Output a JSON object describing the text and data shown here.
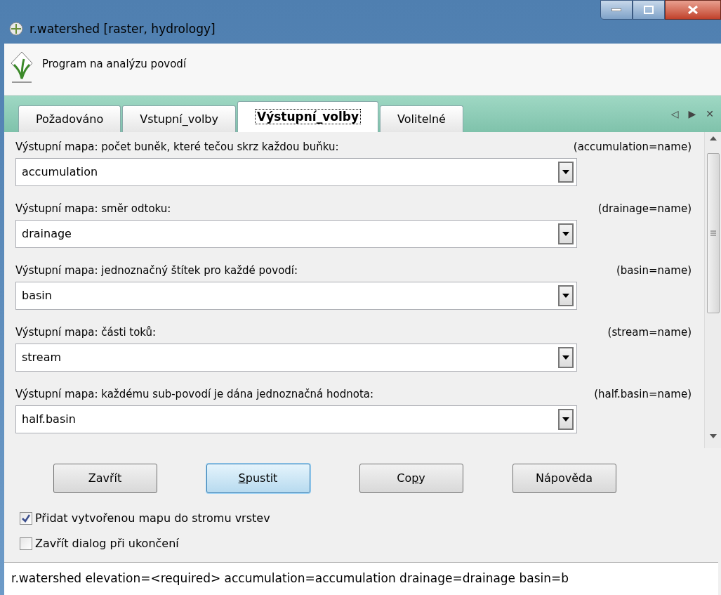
{
  "window": {
    "title": "r.watershed [raster, hydrology]"
  },
  "header": {
    "description": "Program na analýzu povodí"
  },
  "tabs": [
    {
      "label": "Požadováno",
      "selected": false
    },
    {
      "label": "Vstupní_volby",
      "selected": false
    },
    {
      "label": "Výstupní_volby",
      "selected": true
    },
    {
      "label": "Volitelné",
      "selected": false
    }
  ],
  "tab_nav": [
    "◁",
    "▶",
    "✕"
  ],
  "options": [
    {
      "label": "Výstupní mapa: počet buněk, které tečou skrz každou buňku:",
      "key": "(accumulation=name)",
      "value": "accumulation"
    },
    {
      "label": "Výstupní mapa: směr odtoku:",
      "key": "(drainage=name)",
      "value": "drainage"
    },
    {
      "label": "Výstupní mapa: jednoznačný štítek pro každé povodí:",
      "key": "(basin=name)",
      "value": "basin"
    },
    {
      "label": "Výstupní mapa: části toků:",
      "key": "(stream=name)",
      "value": "stream"
    },
    {
      "label": "Výstupní mapa: každému sub-povodí je dána jednoznačná hodnota:",
      "key": "(half.basin=name)",
      "value": "half.basin"
    }
  ],
  "buttons": [
    {
      "parts": [
        {
          "t": "Zavřít",
          "u": false
        }
      ],
      "default": false
    },
    {
      "parts": [
        {
          "t": "S",
          "u": true
        },
        {
          "t": "pustit",
          "u": false
        }
      ],
      "default": true
    },
    {
      "parts": [
        {
          "t": "Co",
          "u": false
        },
        {
          "t": "p",
          "u": true
        },
        {
          "t": "y",
          "u": false
        }
      ],
      "default": false
    },
    {
      "parts": [
        {
          "t": "Nápověda",
          "u": false
        }
      ],
      "default": false
    }
  ],
  "checkboxes": [
    {
      "label": "Přidat vytvořenou mapu do stromu vrstev",
      "checked": true
    },
    {
      "label": "Zavřít dialog při ukončení",
      "checked": false
    }
  ],
  "status_bar": "r.watershed elevation=<required> accumulation=accumulation drainage=drainage basin=b"
}
